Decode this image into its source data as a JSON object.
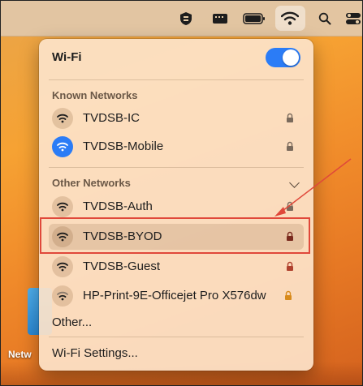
{
  "menubar": {
    "icons": [
      "vpn-icon",
      "keyboard-icon",
      "battery-icon",
      "wifi-icon",
      "search-icon",
      "control-center-icon"
    ]
  },
  "wifi_menu": {
    "title": "Wi-Fi",
    "toggle_on": true,
    "known_header": "Known Networks",
    "other_header": "Other Networks",
    "known": [
      {
        "name": "TVDSB-IC",
        "active": false,
        "locked": true
      },
      {
        "name": "TVDSB-Mobile",
        "active": true,
        "locked": true
      }
    ],
    "other": [
      {
        "name": "TVDSB-Auth",
        "locked": true
      },
      {
        "name": "TVDSB-BYOD",
        "locked": true
      },
      {
        "name": "TVDSB-Guest",
        "locked": true
      },
      {
        "name": "HP-Print-9E-Officejet Pro X576dw",
        "locked": true
      }
    ],
    "other_label": "Other...",
    "settings_label": "Wi-Fi Settings..."
  },
  "desktop": {
    "label": "Netw"
  },
  "annotation": {
    "color": "#e0483a"
  }
}
